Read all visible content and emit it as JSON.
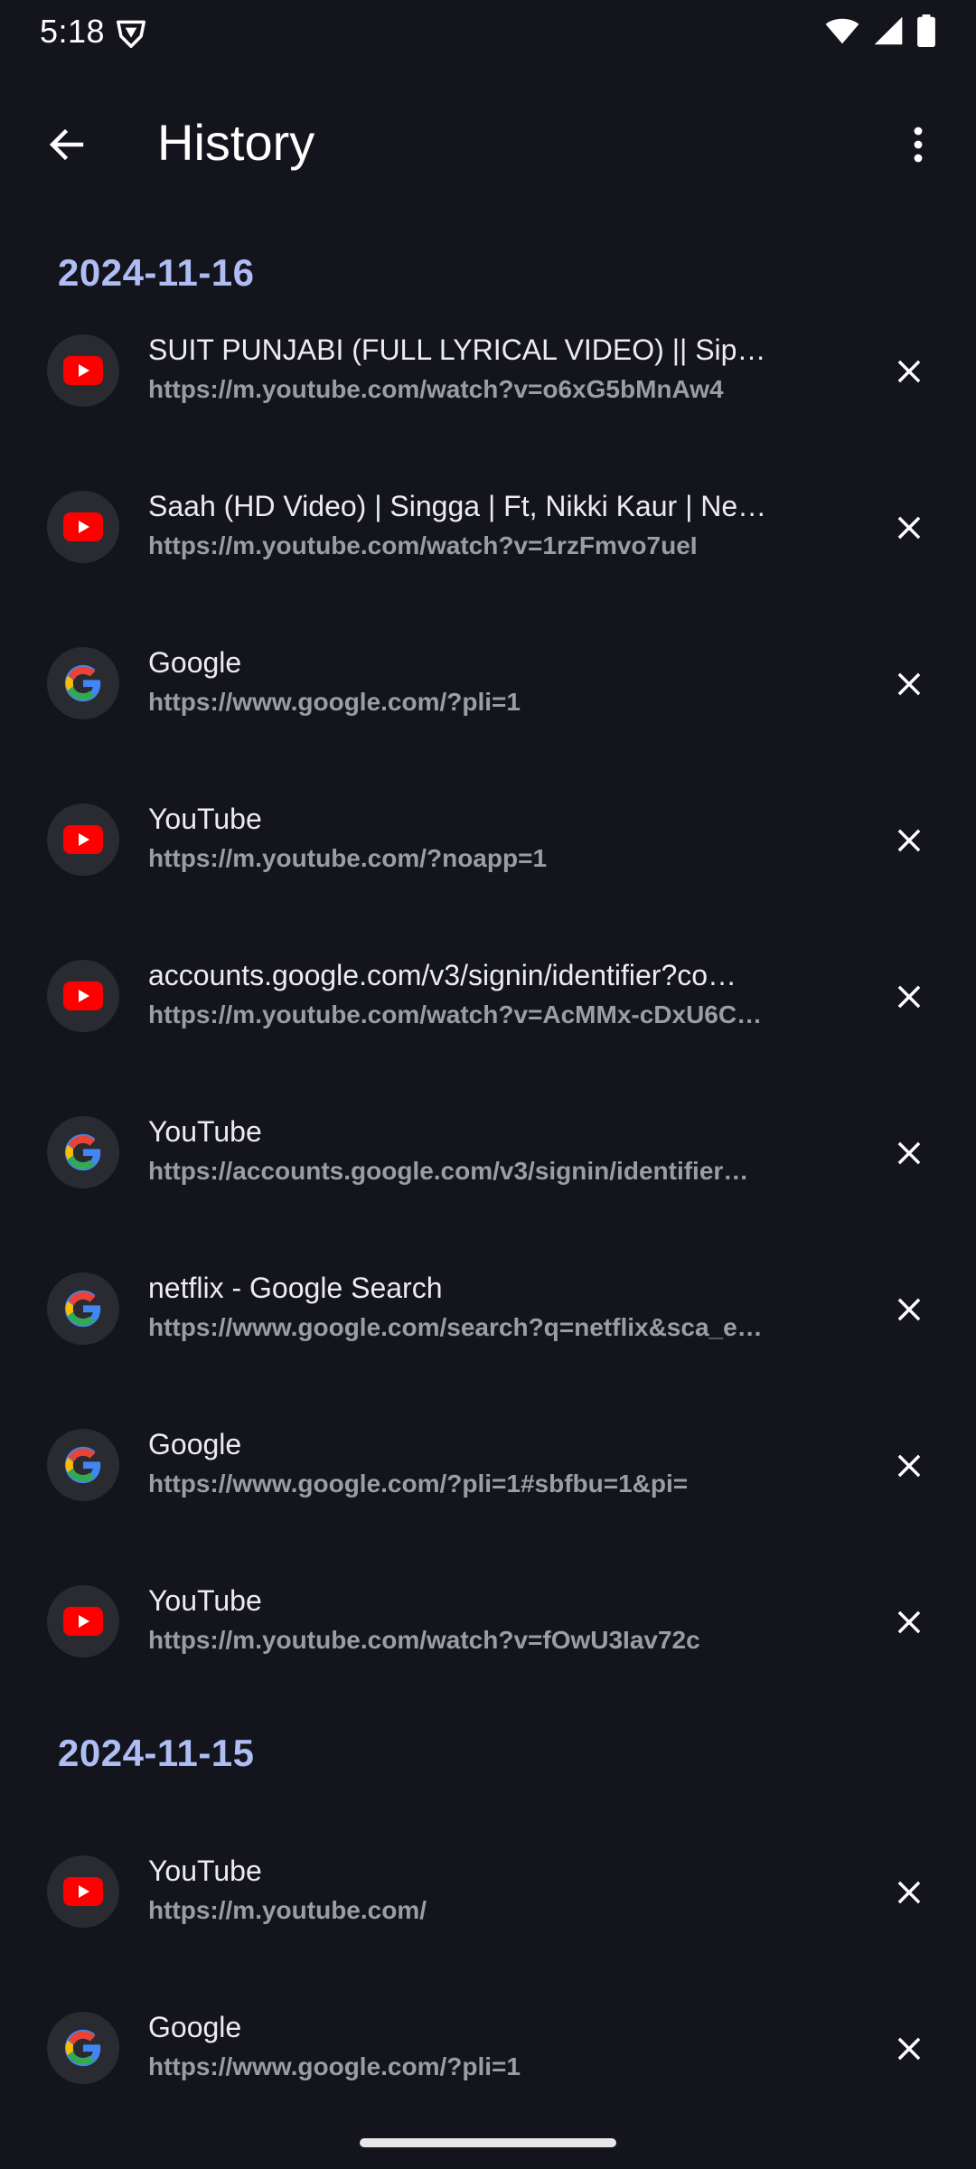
{
  "status_bar": {
    "time": "5:18",
    "icons": [
      "vpn-shield-icon",
      "wifi-icon",
      "signal-icon",
      "battery-icon"
    ]
  },
  "app_bar": {
    "title": "History",
    "back_icon": "arrow-back-icon",
    "menu_icon": "more-vert-icon"
  },
  "colors": {
    "background": "#14151c",
    "date_header": "#aebdf3",
    "youtube_red": "#ff0000",
    "favicon_bg": "#2a2b31"
  },
  "groups": [
    {
      "date": "2024-11-16",
      "items": [
        {
          "icon": "youtube-icon",
          "title": "SUIT PUNJABI (FULL LYRICAL VIDEO) || Sippy …",
          "url": "https://m.youtube.com/watch?v=o6xG5bMnAw4"
        },
        {
          "icon": "youtube-icon",
          "title": "Saah (HD Video) | Singga | Ft, Nikki Kaur | Ne…",
          "url": "https://m.youtube.com/watch?v=1rzFmvo7ueI"
        },
        {
          "icon": "google-icon",
          "title": "Google",
          "url": "https://www.google.com/?pli=1"
        },
        {
          "icon": "youtube-icon",
          "title": "YouTube",
          "url": "https://m.youtube.com/?noapp=1"
        },
        {
          "icon": "youtube-icon",
          "title": "accounts.google.com/v3/signin/identifier?co…",
          "url": "https://m.youtube.com/watch?v=AcMMx-cDxU6C…"
        },
        {
          "icon": "google-icon",
          "title": "YouTube",
          "url": "https://accounts.google.com/v3/signin/identifier…"
        },
        {
          "icon": "google-icon",
          "title": "netflix - Google Search",
          "url": "https://www.google.com/search?q=netflix&sca_e…"
        },
        {
          "icon": "google-icon",
          "title": "Google",
          "url": "https://www.google.com/?pli=1#sbfbu=1&pi="
        },
        {
          "icon": "youtube-icon",
          "title": "YouTube",
          "url": "https://m.youtube.com/watch?v=fOwU3Iav72c"
        }
      ]
    },
    {
      "date": "2024-11-15",
      "items": [
        {
          "icon": "youtube-icon",
          "title": "YouTube",
          "url": "https://m.youtube.com/"
        },
        {
          "icon": "google-icon",
          "title": "Google",
          "url": "https://www.google.com/?pli=1"
        }
      ]
    }
  ]
}
